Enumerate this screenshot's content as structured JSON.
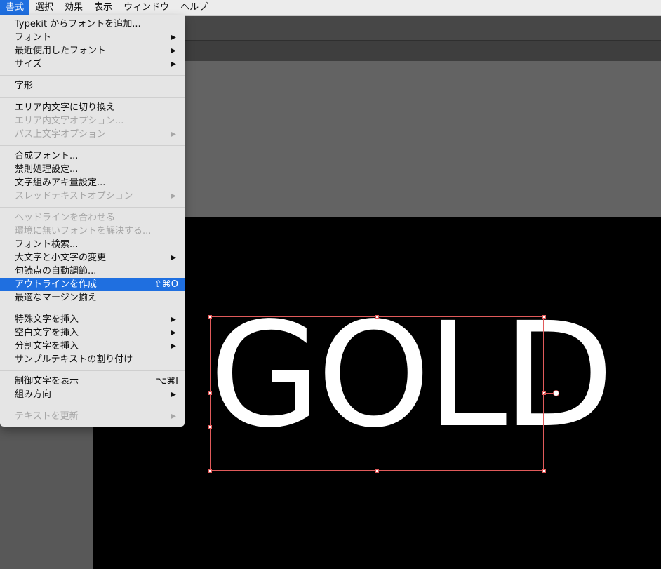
{
  "menubar": {
    "items": [
      "書式",
      "選択",
      "効果",
      "表示",
      "ウィンドウ",
      "ヘルプ"
    ],
    "active_index": 0
  },
  "menu": {
    "items": [
      {
        "label": "Typekit からフォントを追加...",
        "shortcut": "",
        "submenu": false,
        "disabled": false
      },
      {
        "label": "フォント",
        "shortcut": "",
        "submenu": true,
        "disabled": false
      },
      {
        "label": "最近使用したフォント",
        "shortcut": "",
        "submenu": true,
        "disabled": false
      },
      {
        "label": "サイズ",
        "shortcut": "",
        "submenu": true,
        "disabled": false
      },
      {
        "label": "字形",
        "shortcut": "",
        "submenu": false,
        "disabled": false
      },
      {
        "label": "エリア内文字に切り換え",
        "shortcut": "",
        "submenu": false,
        "disabled": false
      },
      {
        "label": "エリア内文字オプション...",
        "shortcut": "",
        "submenu": false,
        "disabled": true
      },
      {
        "label": "パス上文字オプション",
        "shortcut": "",
        "submenu": true,
        "disabled": true
      },
      {
        "label": "合成フォント...",
        "shortcut": "",
        "submenu": false,
        "disabled": false
      },
      {
        "label": "禁則処理設定...",
        "shortcut": "",
        "submenu": false,
        "disabled": false
      },
      {
        "label": "文字組みアキ量設定...",
        "shortcut": "",
        "submenu": false,
        "disabled": false
      },
      {
        "label": "スレッドテキストオプション",
        "shortcut": "",
        "submenu": true,
        "disabled": true
      },
      {
        "label": "ヘッドラインを合わせる",
        "shortcut": "",
        "submenu": false,
        "disabled": true
      },
      {
        "label": "環境に無いフォントを解決する...",
        "shortcut": "",
        "submenu": false,
        "disabled": true
      },
      {
        "label": "フォント検索...",
        "shortcut": "",
        "submenu": false,
        "disabled": false
      },
      {
        "label": "大文字と小文字の変更",
        "shortcut": "",
        "submenu": true,
        "disabled": false
      },
      {
        "label": "句読点の自動調節...",
        "shortcut": "",
        "submenu": false,
        "disabled": false
      },
      {
        "label": "アウトラインを作成",
        "shortcut": "⇧⌘O",
        "submenu": false,
        "disabled": false,
        "highlighted": true
      },
      {
        "label": "最適なマージン揃え",
        "shortcut": "",
        "submenu": false,
        "disabled": false
      },
      {
        "label": "特殊文字を挿入",
        "shortcut": "",
        "submenu": true,
        "disabled": false
      },
      {
        "label": "空白文字を挿入",
        "shortcut": "",
        "submenu": true,
        "disabled": false
      },
      {
        "label": "分割文字を挿入",
        "shortcut": "",
        "submenu": true,
        "disabled": false
      },
      {
        "label": "サンプルテキストの割り付け",
        "shortcut": "",
        "submenu": false,
        "disabled": false
      },
      {
        "label": "制御文字を表示",
        "shortcut": "⌥⌘I",
        "submenu": false,
        "disabled": false
      },
      {
        "label": "組み方向",
        "shortcut": "",
        "submenu": true,
        "disabled": false
      },
      {
        "label": "テキストを更新",
        "shortcut": "",
        "submenu": true,
        "disabled": true
      }
    ],
    "submenu_arrow": "▶"
  },
  "canvas": {
    "text": "GOLD",
    "text_color": "#ffffff",
    "background": "#000000",
    "selection_color": "#e05a5a"
  },
  "colors": {
    "highlight": "#1f6fe0"
  }
}
